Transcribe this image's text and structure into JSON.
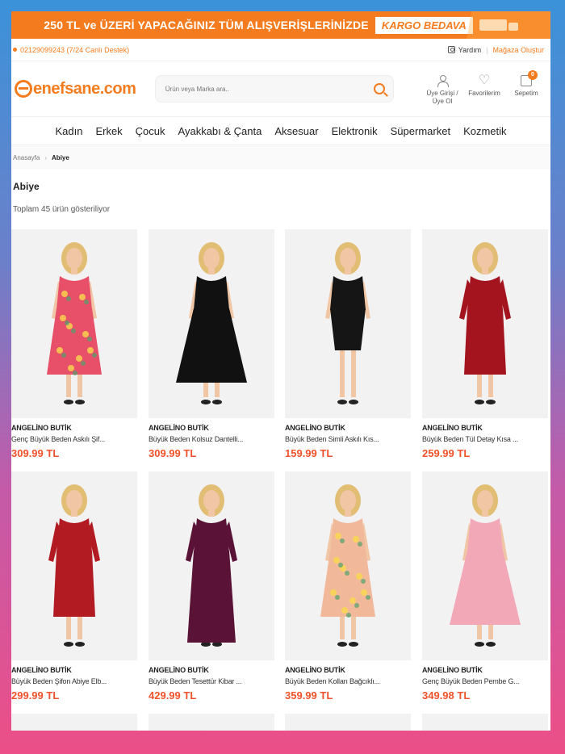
{
  "promo": {
    "text": "250 TL ve ÜZERİ YAPACAĞINIZ TÜM ALIŞVERİŞLERİNİZDE",
    "badge": "KARGO BEDAVA"
  },
  "topbar": {
    "phone": "02129099243 (7/24 Canlı Destek)",
    "help": "Yardım",
    "store": "Mağaza Oluştur"
  },
  "header": {
    "logo": "enefsane.com",
    "search_placeholder": "Ürün veya Marka ara..",
    "account_label": "Üye Girişi / Üye Ol",
    "favorites_label": "Favorilerim",
    "cart_label": "Sepetim",
    "cart_count": "0"
  },
  "nav": [
    "Kadın",
    "Erkek",
    "Çocuk",
    "Ayakkabı & Çanta",
    "Aksesuar",
    "Elektronik",
    "Süpermarket",
    "Kozmetik"
  ],
  "breadcrumb": {
    "home": "Anasayfa",
    "current": "Abiye"
  },
  "page": {
    "title": "Abiye",
    "count": "Toplam 45 ürün gösteriliyor"
  },
  "products": [
    {
      "brand": "ANGELİNO BUTİK",
      "name": "Genç Büyük Beden Askılı Şif...",
      "price": "309.99 TL",
      "color": "#e8506a",
      "style": "floral"
    },
    {
      "brand": "ANGELİNO BUTİK",
      "name": "Büyük Beden Kolsuz Dantelli...",
      "price": "309.99 TL",
      "color": "#111111",
      "style": "flare"
    },
    {
      "brand": "ANGELİNO BUTİK",
      "name": "Büyük Beden Simli Askılı Kıs...",
      "price": "159.99 TL",
      "color": "#151515",
      "style": "short"
    },
    {
      "brand": "ANGELİNO BUTİK",
      "name": "Büyük Beden Tül Detay Kısa ...",
      "price": "259.99 TL",
      "color": "#a3141f",
      "style": "sleeve"
    },
    {
      "brand": "ANGELİNO BUTİK",
      "name": "Büyük Beden Şifon Abiye Elb...",
      "price": "299.99 TL",
      "color": "#b21b22",
      "style": "sleeve"
    },
    {
      "brand": "ANGELİNO BUTİK",
      "name": "Büyük Beden Tesettür Kibar ...",
      "price": "429.99 TL",
      "color": "#5a1236",
      "style": "long"
    },
    {
      "brand": "ANGELİNO BUTİK",
      "name": "Büyük Beden Kolları Bağcıklı...",
      "price": "359.99 TL",
      "color": "#f1b89a",
      "style": "floral"
    },
    {
      "brand": "ANGELİNO BUTİK",
      "name": "Genç Büyük Beden Pembe G...",
      "price": "349.98 TL",
      "color": "#f3a8b8",
      "style": "flare"
    }
  ]
}
